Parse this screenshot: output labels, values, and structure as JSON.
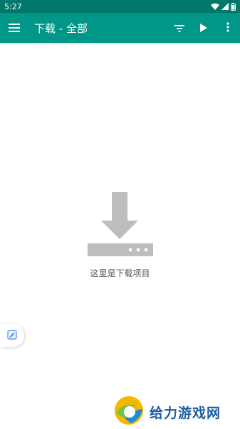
{
  "status_bar": {
    "time": "5:27",
    "icons": [
      "wifi-icon",
      "signal-icon",
      "battery-icon"
    ]
  },
  "app_bar": {
    "title": "下载 - 全部",
    "nav_icon": "menu-icon",
    "actions": [
      "filter-icon",
      "play-icon",
      "more-vert-icon"
    ],
    "background_color": "#009688",
    "status_bar_color": "#00796b"
  },
  "empty_state": {
    "message": "这里是下载项目",
    "icon": "download-icon"
  },
  "floating_tab": {
    "icon": "note-icon"
  },
  "watermark": {
    "text": "给力游戏网",
    "text_color": "#1b5e9e"
  }
}
